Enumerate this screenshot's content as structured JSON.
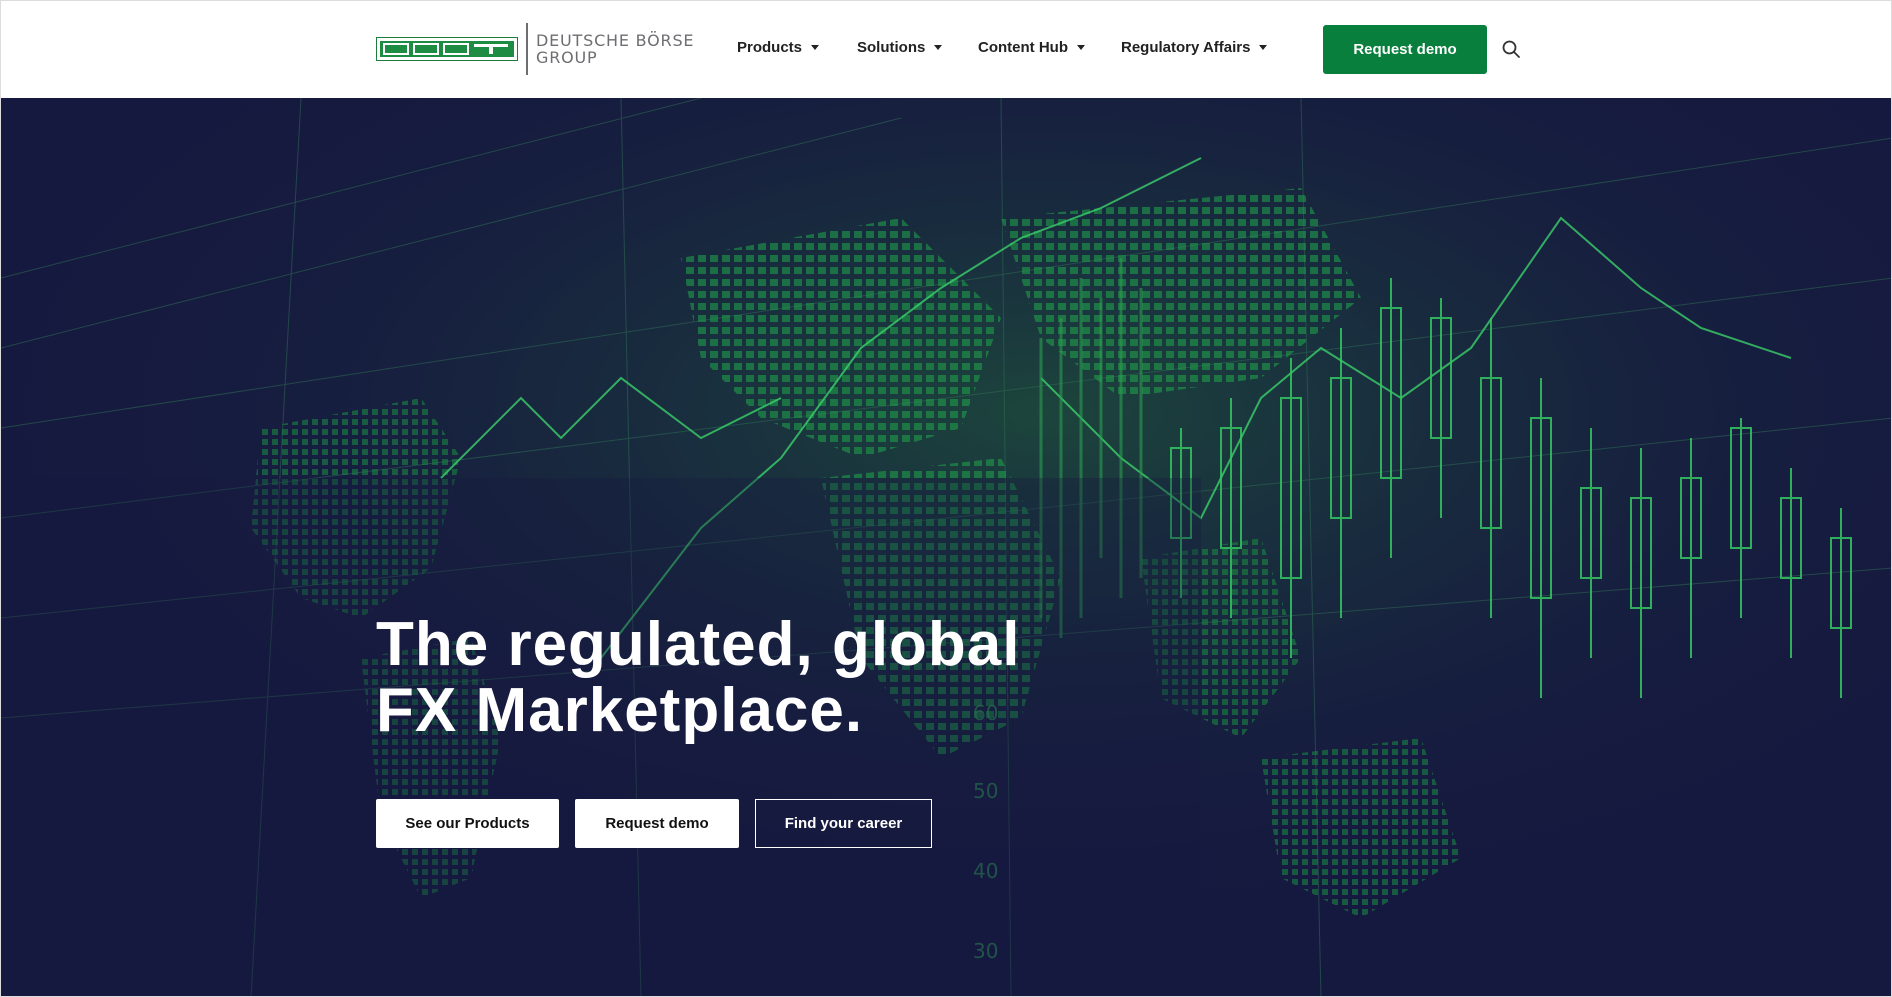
{
  "header": {
    "logo_mark_text": "360T",
    "logo_text_line1": "DEUTSCHE BÖRSE",
    "logo_text_line2": "GROUP",
    "nav": [
      {
        "label": "Products"
      },
      {
        "label": "Solutions"
      },
      {
        "label": "Content Hub"
      },
      {
        "label": "Regulatory Affairs"
      }
    ],
    "request_demo_label": "Request demo",
    "search_icon": "search-icon"
  },
  "hero": {
    "title_line1": "The regulated, global",
    "title_line2": "FX Marketplace.",
    "buttons": {
      "products": "See our Products",
      "demo": "Request demo",
      "career": "Find your career"
    },
    "background_image": "world-map-candlestick-chart"
  },
  "colors": {
    "brand_green": "#087f3c",
    "hero_navy": "#16193f",
    "chart_green": "#2fbf55",
    "nav_text": "#222222"
  }
}
